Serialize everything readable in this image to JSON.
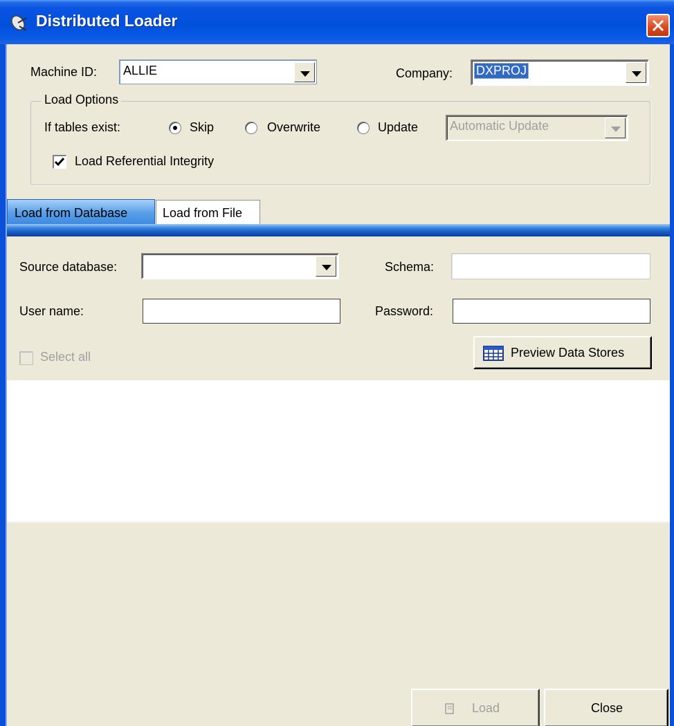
{
  "window": {
    "title": "Distributed Loader",
    "title_icon": "satellite-dish-icon"
  },
  "machine": {
    "label": "Machine ID:",
    "value": "ALLIE"
  },
  "company": {
    "label": "Company:",
    "value": "DXPROJ"
  },
  "load_options": {
    "legend": "Load Options",
    "if_tables_exist_label": "If tables exist:",
    "options": [
      "Skip",
      "Overwrite",
      "Update"
    ],
    "selected": "Skip",
    "update_mode": "Automatic Update",
    "referential_label": "Load Referential Integrity",
    "referential_checked": true
  },
  "tabs": {
    "active": "Load from Database",
    "inactive": "Load from File"
  },
  "db_form": {
    "source_label": "Source database:",
    "source_value": "",
    "schema_label": "Schema:",
    "schema_value": "",
    "user_label": "User name:",
    "user_value": "",
    "password_label": "Password:",
    "password_value": "",
    "select_all_label": "Select all",
    "preview_label": "Preview Data Stores",
    "preview_icon": "table-grid-icon"
  },
  "footer": {
    "load_label": "Load",
    "load_icon": "load-icon",
    "close_label": "Close"
  }
}
